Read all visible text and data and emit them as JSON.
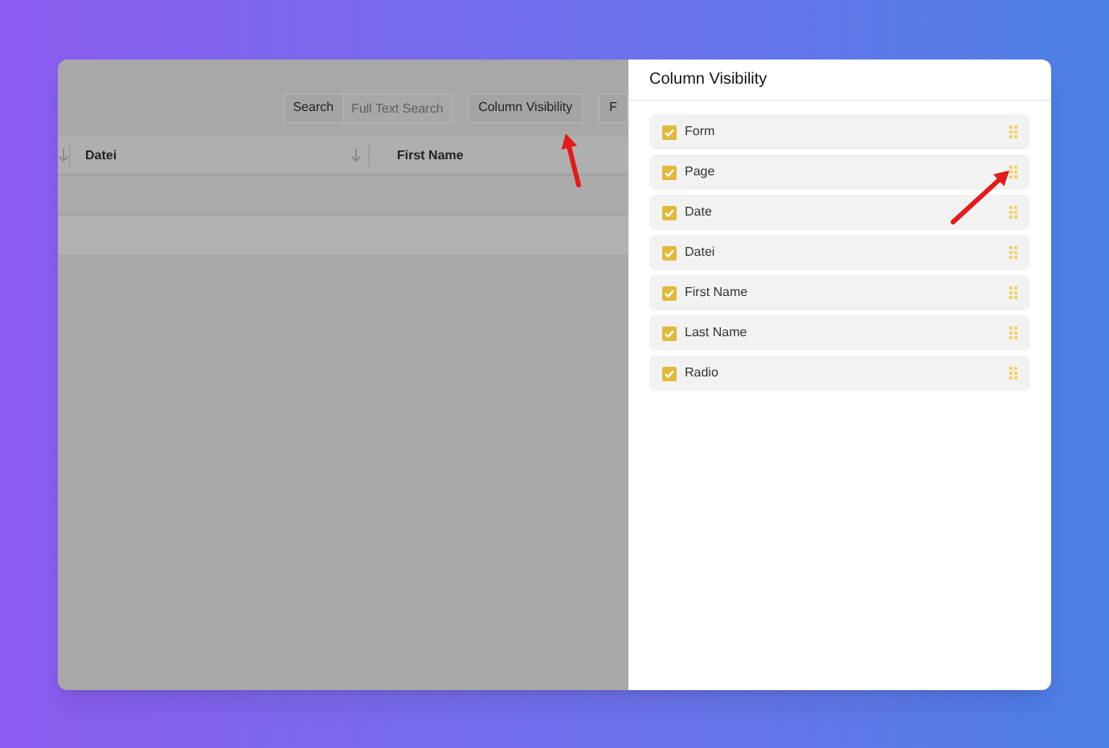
{
  "toolbar": {
    "search_label": "Search",
    "search": {
      "placeholder": "Full Text Search"
    },
    "buttons": [
      "Column Visibility",
      "F"
    ]
  },
  "table": {
    "columns": [
      "Datei",
      "First Name"
    ]
  },
  "drawer": {
    "title": "Column Visibility",
    "items": [
      {
        "label": "Form",
        "checked": true
      },
      {
        "label": "Page",
        "checked": true
      },
      {
        "label": "Date",
        "checked": true
      },
      {
        "label": "Datei",
        "checked": true
      },
      {
        "label": "First Name",
        "checked": true
      },
      {
        "label": "Last Name",
        "checked": true
      },
      {
        "label": "Radio",
        "checked": true
      }
    ]
  }
}
